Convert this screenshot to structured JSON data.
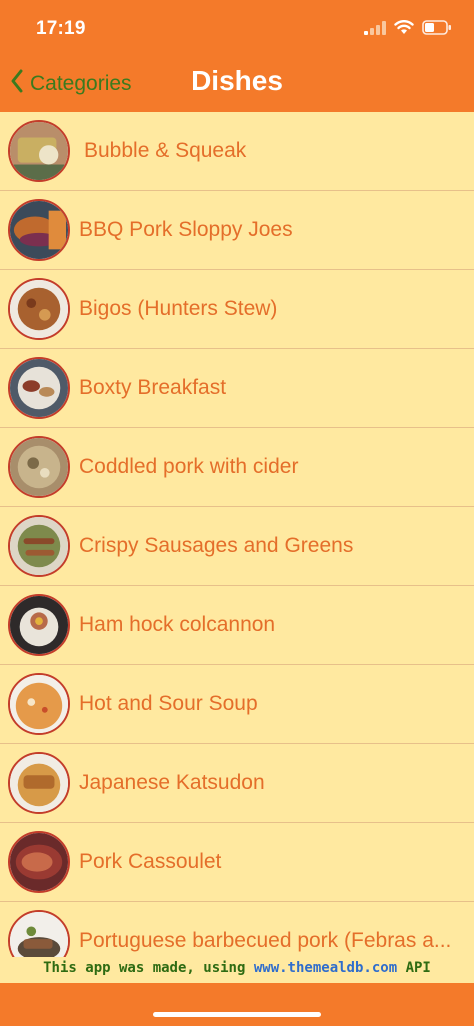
{
  "status": {
    "time": "17:19"
  },
  "nav": {
    "back_label": "Categories",
    "title": "Dishes"
  },
  "dishes": [
    {
      "name": "Bubble & Squeak"
    },
    {
      "name": "BBQ Pork Sloppy Joes"
    },
    {
      "name": "Bigos (Hunters Stew)"
    },
    {
      "name": "Boxty Breakfast"
    },
    {
      "name": "Coddled pork with cider"
    },
    {
      "name": "Crispy Sausages and Greens"
    },
    {
      "name": "Ham hock colcannon"
    },
    {
      "name": "Hot and Sour Soup"
    },
    {
      "name": "Japanese Katsudon"
    },
    {
      "name": "Pork Cassoulet"
    },
    {
      "name": "Portuguese barbecued pork (Febras a..."
    }
  ],
  "footer": {
    "prefix": "This app was made, using ",
    "link": "www.themealdb.com",
    "suffix": " API"
  },
  "colors": {
    "bar": "#F47A2A",
    "background": "#FFE9A0",
    "label": "#E46E2A",
    "back": "#3C7A1E"
  }
}
